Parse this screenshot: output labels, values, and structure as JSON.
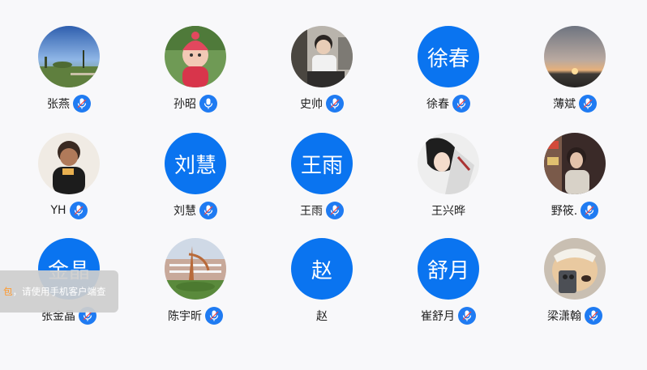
{
  "members": [
    {
      "name": "张燕",
      "avatar": {
        "type": "photo",
        "icon": "landscape-photo"
      },
      "mic": true
    },
    {
      "name": "孙昭",
      "avatar": {
        "type": "photo",
        "icon": "baby-photo"
      },
      "mic": true
    },
    {
      "name": "史帅",
      "avatar": {
        "type": "photo",
        "icon": "person-photo"
      },
      "mic": true
    },
    {
      "name": "徐春",
      "avatar": {
        "type": "text",
        "text": "徐春"
      },
      "mic": true
    },
    {
      "name": "薄斌",
      "avatar": {
        "type": "photo",
        "icon": "sunset-photo"
      },
      "mic": true
    },
    {
      "name": "YH",
      "avatar": {
        "type": "photo",
        "icon": "child-photo"
      },
      "mic": true
    },
    {
      "name": "刘慧",
      "avatar": {
        "type": "text",
        "text": "刘慧"
      },
      "mic": true
    },
    {
      "name": "王雨",
      "avatar": {
        "type": "text",
        "text": "王雨"
      },
      "mic": true
    },
    {
      "name": "王兴晔",
      "avatar": {
        "type": "photo",
        "icon": "anime-photo"
      },
      "mic": false
    },
    {
      "name": "野筱.",
      "avatar": {
        "type": "photo",
        "icon": "woman-photo"
      },
      "mic": true
    },
    {
      "name": "张金晶",
      "avatar": {
        "type": "text",
        "text": "金晶"
      },
      "mic": true
    },
    {
      "name": "陈宇昕",
      "avatar": {
        "type": "photo",
        "icon": "building-photo"
      },
      "mic": true
    },
    {
      "name": "赵",
      "avatar": {
        "type": "text",
        "text": "赵"
      },
      "mic": false
    },
    {
      "name": "崔舒月",
      "avatar": {
        "type": "text",
        "text": "舒月"
      },
      "mic": true
    },
    {
      "name": "梁潇翰",
      "avatar": {
        "type": "photo",
        "icon": "dog-photo"
      },
      "mic": true
    }
  ],
  "toast": {
    "highlight": "包",
    "text": "，请使用手机客户端查"
  },
  "colors": {
    "accent": "#0a74f0",
    "mic_badge": "#1f7bf2",
    "background": "#f8f8fa",
    "toast_highlight": "#ff9a2e"
  }
}
